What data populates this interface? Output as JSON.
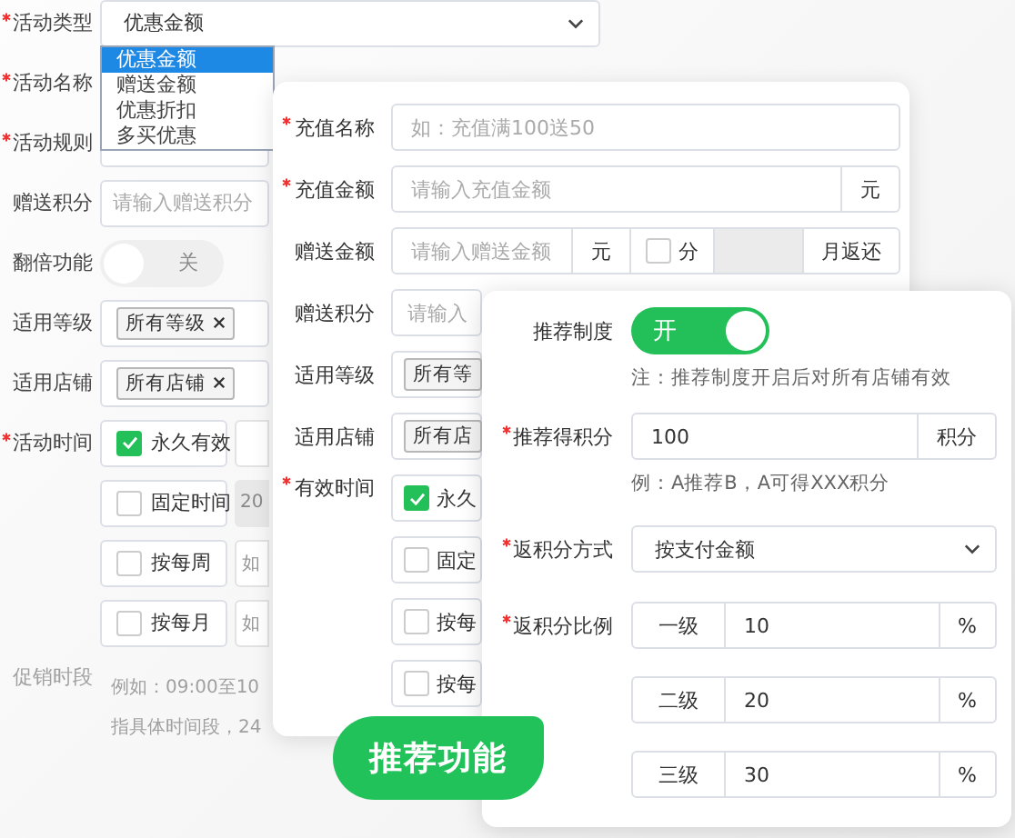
{
  "activity_form": {
    "rows": [
      {
        "kind": "select",
        "label": "活动类型",
        "required": true,
        "value": "优惠金额",
        "options": [
          {
            "label": "优惠金额",
            "selected": true
          },
          {
            "label": "赠送金额",
            "selected": false
          },
          {
            "label": "优惠折扣",
            "selected": false
          },
          {
            "label": "多买优惠",
            "selected": false
          }
        ]
      },
      {
        "kind": "input",
        "label": "活动名称",
        "required": true
      },
      {
        "kind": "split",
        "label": "活动规则",
        "required": true
      },
      {
        "kind": "input",
        "label": "赠送积分",
        "required": false,
        "placeholder": "请输入赠送积分"
      },
      {
        "kind": "toggle",
        "label": "翻倍功能",
        "required": false,
        "on": false,
        "text": "关"
      },
      {
        "kind": "tags",
        "label": "适用等级",
        "required": false,
        "removable": true,
        "tags": [
          "所有等级"
        ]
      },
      {
        "kind": "tags",
        "label": "适用店铺",
        "required": false,
        "removable": true,
        "tags": [
          "所有店铺"
        ]
      },
      {
        "kind": "checks",
        "label": "活动时间",
        "required": true,
        "options": [
          {
            "label": "永久有效",
            "checked": true
          },
          {
            "label": "固定时间",
            "checked": false,
            "extra": "20"
          },
          {
            "label": "按每周",
            "checked": false,
            "extra": "如"
          },
          {
            "label": "按每月",
            "checked": false,
            "extra": "如"
          }
        ]
      },
      {
        "kind": "hint",
        "label": "促销时段",
        "required": false,
        "lines": [
          "例如：09:00至10",
          "指具体时间段，24"
        ]
      }
    ]
  },
  "recharge_form": {
    "rows": [
      {
        "kind": "input",
        "label": "充值名称",
        "required": true,
        "placeholder": "如：充值满100送50"
      },
      {
        "kind": "unit",
        "label": "充值金额",
        "required": true,
        "placeholder": "请输入充值金额",
        "unit": "元"
      },
      {
        "kind": "gift",
        "label": "赠送金额",
        "required": false,
        "placeholder": "请输入赠送金额",
        "unit": "元",
        "check_label": "分",
        "checked": false,
        "suffix": "月返还"
      },
      {
        "kind": "input",
        "label": "赠送积分",
        "required": false,
        "placeholder": "请输入"
      },
      {
        "kind": "tags",
        "label": "适用等级",
        "required": false,
        "removable": false,
        "tags": [
          "所有等"
        ]
      },
      {
        "kind": "tags",
        "label": "适用店铺",
        "required": false,
        "removable": false,
        "tags": [
          "所有店"
        ]
      },
      {
        "kind": "checks",
        "label": "有效时间",
        "required": true,
        "options": [
          {
            "label": "永久",
            "checked": true
          },
          {
            "label": "固定",
            "checked": false
          },
          {
            "label": "按每",
            "checked": false
          },
          {
            "label": "按每",
            "checked": false
          }
        ]
      }
    ]
  },
  "referral_form": {
    "rows": [
      {
        "kind": "toggle",
        "label": "推荐制度",
        "required": false,
        "on": true,
        "text": "开",
        "note": "注：推荐制度开启后对所有店铺有效"
      },
      {
        "kind": "unit",
        "label": "推荐得积分",
        "required": true,
        "value": "100",
        "unit": "积分",
        "note": "例：A推荐B，A可得XXX积分"
      },
      {
        "kind": "select",
        "label": "返积分方式",
        "required": true,
        "value": "按支付金额"
      },
      {
        "kind": "ratio",
        "label": "返积分比例",
        "required": true,
        "levels": [
          {
            "name": "一级",
            "value": "10",
            "unit": "%"
          },
          {
            "name": "二级",
            "value": "20",
            "unit": "%"
          },
          {
            "name": "三级",
            "value": "30",
            "unit": "%"
          }
        ]
      }
    ]
  },
  "feature_bubble": {
    "text": "推荐功能"
  }
}
